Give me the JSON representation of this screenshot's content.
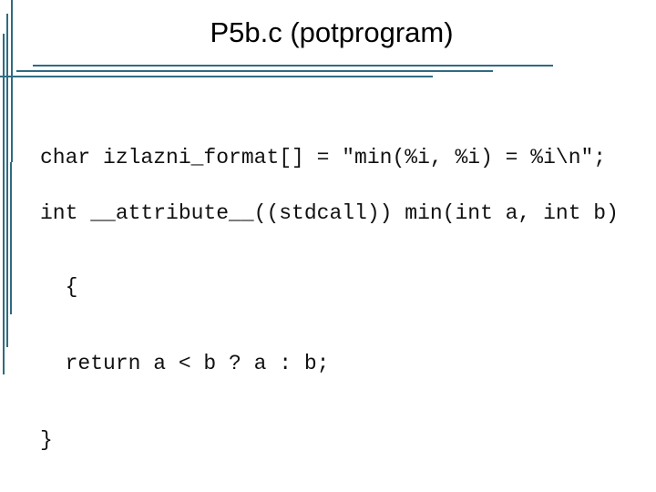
{
  "slide": {
    "title": "P5b.c (potprogram)",
    "accent_color": "#2f6b82",
    "code": {
      "declaration": "char izlazni_format[] = \"min(%i, %i) = %i\\n\";",
      "function_lines": [
        "int __attribute__((stdcall)) min(int a, int b)",
        "  {",
        "  return a < b ? a : b;",
        "}"
      ]
    }
  }
}
